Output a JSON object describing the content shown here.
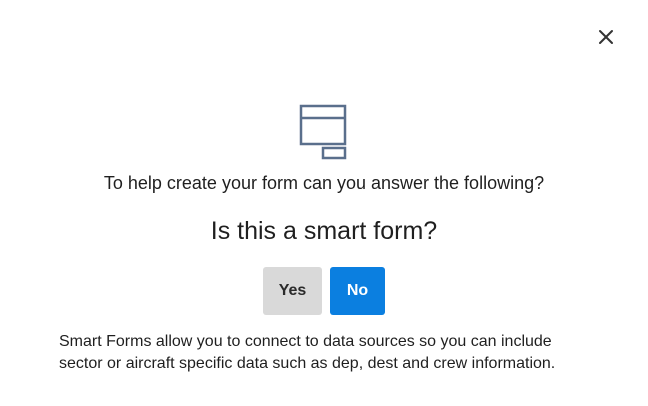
{
  "dialog": {
    "close_icon": "close-icon",
    "form_icon": "form-icon",
    "prompt": "To help create your form can you answer the following?",
    "question": "Is this a smart form?",
    "buttons": {
      "yes_label": "Yes",
      "no_label": "No"
    },
    "info_line1": "Smart Forms allow you to connect to data sources so you can include",
    "info_line2": "sector or aircraft specific data such as dep, dest and crew information."
  },
  "colors": {
    "primary": "#0b7fe0",
    "secondary_button": "#d9d9d9",
    "icon_stroke": "#5a6f8c"
  }
}
